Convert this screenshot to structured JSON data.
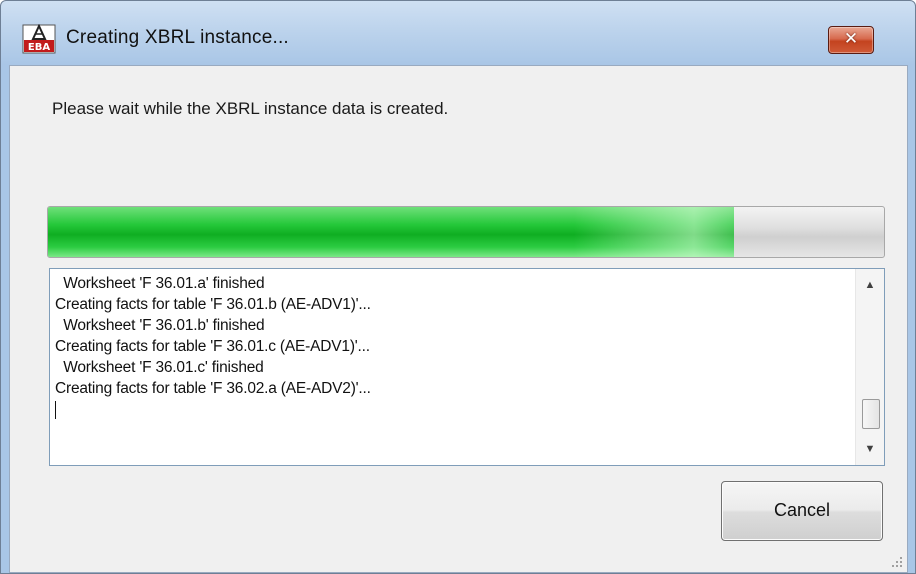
{
  "window": {
    "title": "Creating XBRL instance...",
    "icon": "eba-app-icon",
    "close_label": "✕"
  },
  "dialog": {
    "message": "Please wait while the XBRL instance data is created.",
    "progress_fraction": 0.82,
    "log_lines": [
      "  Worksheet 'F 36.01.a' finished",
      "Creating facts for table 'F 36.01.b (AE-ADV1)'...",
      "  Worksheet 'F 36.01.b' finished",
      "Creating facts for table 'F 36.01.c (AE-ADV1)'...",
      "  Worksheet 'F 36.01.c' finished",
      "Creating facts for table 'F 36.02.a (AE-ADV2)'..."
    ],
    "cancel_label": "Cancel"
  },
  "colors": {
    "progress_green": "#14b428",
    "close_red": "#c4431f",
    "title_gradient": "#bcd3ec"
  }
}
